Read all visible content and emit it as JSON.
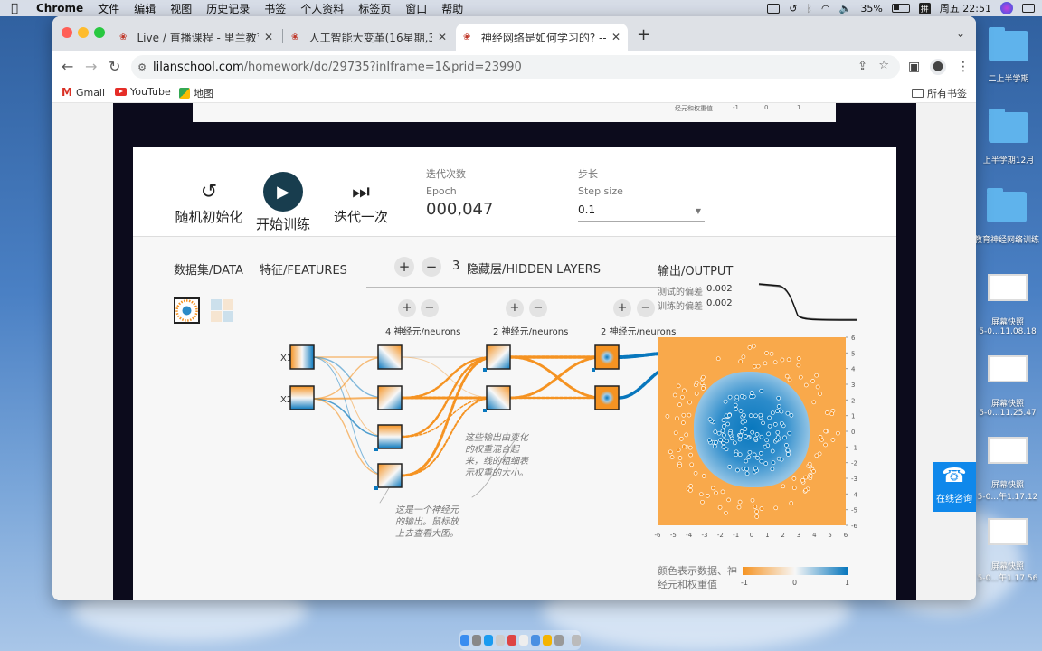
{
  "menubar": {
    "app": "Chrome",
    "items": [
      "文件",
      "编辑",
      "视图",
      "历史记录",
      "书签",
      "个人资料",
      "标签页",
      "窗口",
      "帮助"
    ],
    "battery": "35%",
    "input_method": "拼",
    "clock": "周五 22:51"
  },
  "tabs": [
    {
      "title": "Live / 直播课程 - 里兰教育 - 青"
    },
    {
      "title": "人工智能大变革(16星期,32课时)"
    },
    {
      "title": "神经网络是如何学习的? ---- 普"
    }
  ],
  "address": {
    "host": "lilanschool.com",
    "path": "/homework/do/29735?inIframe=1&prid=23990"
  },
  "bookmarks": {
    "gmail": "Gmail",
    "youtube": "YouTube",
    "maps": "地图",
    "all": "所有书签"
  },
  "topcard": {
    "text": "经元和权重值",
    "ticks": [
      "-1",
      "0",
      "1"
    ]
  },
  "controls": {
    "reset": "随机初始化",
    "play": "开始训练",
    "step": "迭代一次",
    "epoch_zh": "迭代次数",
    "epoch_en": "Epoch",
    "epoch_value": "000,047",
    "lr_zh": "步长",
    "lr_en": "Step size",
    "lr_value": "0.1"
  },
  "playground": {
    "data_heading": "数据集/DATA",
    "features_heading": "特征/FEATURES",
    "layer_count": "3",
    "layers_heading": "隐藏层/HIDDEN LAYERS",
    "output_heading": "输出/OUTPUT",
    "test_loss_label": "测试的偏差",
    "test_loss": "0.002",
    "train_loss_label": "训练的偏差",
    "train_loss": "0.002",
    "features": [
      "X1",
      "X2"
    ],
    "layers": [
      {
        "neurons": "4 神经元/neurons"
      },
      {
        "neurons": "2 神经元/neurons"
      },
      {
        "neurons": "2 神经元/neurons"
      }
    ],
    "note_weights": "这些输出由变化的权重混合起来，线的粗细表示权重的大小。",
    "note_weights_lines": [
      "这些输出由变化",
      "的权重混合起",
      "来，线的粗细表",
      "示权重的大小。"
    ],
    "note_neuron_lines": [
      "这是一个神经元",
      "的输出。鼠标放",
      "上去查看大图。"
    ],
    "y_ticks": [
      "6",
      "5",
      "4",
      "3",
      "2",
      "1",
      "0",
      "-1",
      "-2",
      "-3",
      "-4",
      "-5",
      "-6"
    ],
    "x_ticks": [
      "-6",
      "-5",
      "-4",
      "-3",
      "-2",
      "-1",
      "0",
      "1",
      "2",
      "3",
      "4",
      "5",
      "6"
    ],
    "legend_lines": [
      "颜色表示数据、神",
      "经元和权重值"
    ],
    "legend_ticks": [
      "-1",
      "0",
      "1"
    ],
    "colors": {
      "positive": "#0877bd",
      "negative": "#f59322"
    }
  },
  "chat": {
    "label": "在线咨询"
  },
  "desktop": {
    "items": [
      "二上半学期",
      "上半学期12月",
      "教育神经网络训练",
      "屏幕快照",
      "5-0...11.08.18",
      "屏幕快照",
      "5-0...11.25.47",
      "屏幕快照",
      "5-0...午1.17.12",
      "屏幕快照",
      "5-0...午1.17.56"
    ]
  }
}
